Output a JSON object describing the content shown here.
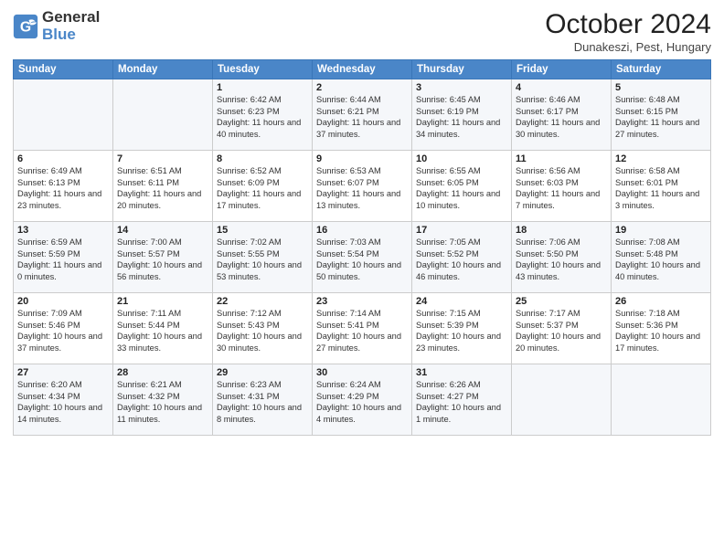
{
  "logo": {
    "line1": "General",
    "line2": "Blue"
  },
  "header": {
    "month_year": "October 2024",
    "location": "Dunakeszi, Pest, Hungary"
  },
  "weekdays": [
    "Sunday",
    "Monday",
    "Tuesday",
    "Wednesday",
    "Thursday",
    "Friday",
    "Saturday"
  ],
  "weeks": [
    [
      {
        "day": "",
        "content": ""
      },
      {
        "day": "",
        "content": ""
      },
      {
        "day": "1",
        "content": "Sunrise: 6:42 AM\nSunset: 6:23 PM\nDaylight: 11 hours and 40 minutes."
      },
      {
        "day": "2",
        "content": "Sunrise: 6:44 AM\nSunset: 6:21 PM\nDaylight: 11 hours and 37 minutes."
      },
      {
        "day": "3",
        "content": "Sunrise: 6:45 AM\nSunset: 6:19 PM\nDaylight: 11 hours and 34 minutes."
      },
      {
        "day": "4",
        "content": "Sunrise: 6:46 AM\nSunset: 6:17 PM\nDaylight: 11 hours and 30 minutes."
      },
      {
        "day": "5",
        "content": "Sunrise: 6:48 AM\nSunset: 6:15 PM\nDaylight: 11 hours and 27 minutes."
      }
    ],
    [
      {
        "day": "6",
        "content": "Sunrise: 6:49 AM\nSunset: 6:13 PM\nDaylight: 11 hours and 23 minutes."
      },
      {
        "day": "7",
        "content": "Sunrise: 6:51 AM\nSunset: 6:11 PM\nDaylight: 11 hours and 20 minutes."
      },
      {
        "day": "8",
        "content": "Sunrise: 6:52 AM\nSunset: 6:09 PM\nDaylight: 11 hours and 17 minutes."
      },
      {
        "day": "9",
        "content": "Sunrise: 6:53 AM\nSunset: 6:07 PM\nDaylight: 11 hours and 13 minutes."
      },
      {
        "day": "10",
        "content": "Sunrise: 6:55 AM\nSunset: 6:05 PM\nDaylight: 11 hours and 10 minutes."
      },
      {
        "day": "11",
        "content": "Sunrise: 6:56 AM\nSunset: 6:03 PM\nDaylight: 11 hours and 7 minutes."
      },
      {
        "day": "12",
        "content": "Sunrise: 6:58 AM\nSunset: 6:01 PM\nDaylight: 11 hours and 3 minutes."
      }
    ],
    [
      {
        "day": "13",
        "content": "Sunrise: 6:59 AM\nSunset: 5:59 PM\nDaylight: 11 hours and 0 minutes."
      },
      {
        "day": "14",
        "content": "Sunrise: 7:00 AM\nSunset: 5:57 PM\nDaylight: 10 hours and 56 minutes."
      },
      {
        "day": "15",
        "content": "Sunrise: 7:02 AM\nSunset: 5:55 PM\nDaylight: 10 hours and 53 minutes."
      },
      {
        "day": "16",
        "content": "Sunrise: 7:03 AM\nSunset: 5:54 PM\nDaylight: 10 hours and 50 minutes."
      },
      {
        "day": "17",
        "content": "Sunrise: 7:05 AM\nSunset: 5:52 PM\nDaylight: 10 hours and 46 minutes."
      },
      {
        "day": "18",
        "content": "Sunrise: 7:06 AM\nSunset: 5:50 PM\nDaylight: 10 hours and 43 minutes."
      },
      {
        "day": "19",
        "content": "Sunrise: 7:08 AM\nSunset: 5:48 PM\nDaylight: 10 hours and 40 minutes."
      }
    ],
    [
      {
        "day": "20",
        "content": "Sunrise: 7:09 AM\nSunset: 5:46 PM\nDaylight: 10 hours and 37 minutes."
      },
      {
        "day": "21",
        "content": "Sunrise: 7:11 AM\nSunset: 5:44 PM\nDaylight: 10 hours and 33 minutes."
      },
      {
        "day": "22",
        "content": "Sunrise: 7:12 AM\nSunset: 5:43 PM\nDaylight: 10 hours and 30 minutes."
      },
      {
        "day": "23",
        "content": "Sunrise: 7:14 AM\nSunset: 5:41 PM\nDaylight: 10 hours and 27 minutes."
      },
      {
        "day": "24",
        "content": "Sunrise: 7:15 AM\nSunset: 5:39 PM\nDaylight: 10 hours and 23 minutes."
      },
      {
        "day": "25",
        "content": "Sunrise: 7:17 AM\nSunset: 5:37 PM\nDaylight: 10 hours and 20 minutes."
      },
      {
        "day": "26",
        "content": "Sunrise: 7:18 AM\nSunset: 5:36 PM\nDaylight: 10 hours and 17 minutes."
      }
    ],
    [
      {
        "day": "27",
        "content": "Sunrise: 6:20 AM\nSunset: 4:34 PM\nDaylight: 10 hours and 14 minutes."
      },
      {
        "day": "28",
        "content": "Sunrise: 6:21 AM\nSunset: 4:32 PM\nDaylight: 10 hours and 11 minutes."
      },
      {
        "day": "29",
        "content": "Sunrise: 6:23 AM\nSunset: 4:31 PM\nDaylight: 10 hours and 8 minutes."
      },
      {
        "day": "30",
        "content": "Sunrise: 6:24 AM\nSunset: 4:29 PM\nDaylight: 10 hours and 4 minutes."
      },
      {
        "day": "31",
        "content": "Sunrise: 6:26 AM\nSunset: 4:27 PM\nDaylight: 10 hours and 1 minute."
      },
      {
        "day": "",
        "content": ""
      },
      {
        "day": "",
        "content": ""
      }
    ]
  ]
}
